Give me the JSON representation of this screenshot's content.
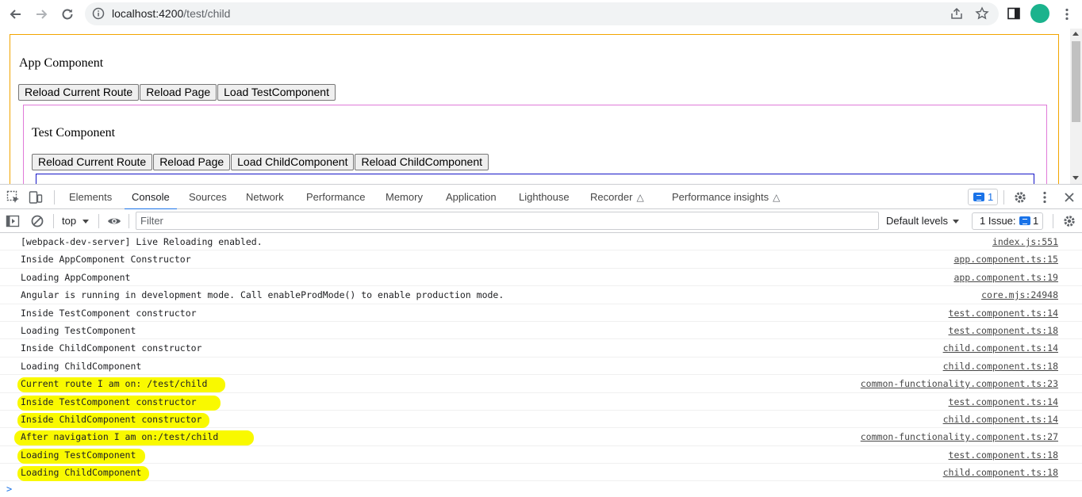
{
  "browser": {
    "url_host": "localhost:4200",
    "url_path": "/test/child"
  },
  "page": {
    "app_title": "App Component",
    "app_buttons": [
      "Reload Current Route",
      "Reload Page",
      "Load TestComponent"
    ],
    "test_title": "Test Component",
    "test_buttons": [
      "Reload Current Route",
      "Reload Page",
      "Load ChildComponent",
      "Reload ChildComponent"
    ]
  },
  "devtools": {
    "tabs": [
      "Elements",
      "Console",
      "Sources",
      "Network",
      "Performance",
      "Memory",
      "Application",
      "Lighthouse",
      "Recorder",
      "Performance insights"
    ],
    "active_tab": "Console",
    "message_count": "1",
    "context": "top",
    "filter_placeholder": "Filter",
    "levels_label": "Default levels",
    "issues_label": "1 Issue:",
    "issues_count": "1",
    "accent_color": "#1a73e8",
    "highlight_color": "#f9f900"
  },
  "console": {
    "rows": [
      {
        "message": "[webpack-dev-server] Live Reloading enabled.",
        "source": "index.js:551",
        "highlighted": false
      },
      {
        "message": "Inside AppComponent Constructor",
        "source": "app.component.ts:15",
        "highlighted": false
      },
      {
        "message": "Loading AppComponent",
        "source": "app.component.ts:19",
        "highlighted": false
      },
      {
        "message": "Angular is running in development mode. Call enableProdMode() to enable production mode.",
        "source": "core.mjs:24948",
        "highlighted": false
      },
      {
        "message": "Inside TestComponent constructor",
        "source": "test.component.ts:14",
        "highlighted": false
      },
      {
        "message": "Loading TestComponent",
        "source": "test.component.ts:18",
        "highlighted": false
      },
      {
        "message": "Inside ChildComponent constructor",
        "source": "child.component.ts:14",
        "highlighted": false
      },
      {
        "message": "Loading ChildComponent",
        "source": "child.component.ts:18",
        "highlighted": false
      },
      {
        "message": "Current route I am on: /test/child",
        "source": "common-functionality.component.ts:23",
        "highlighted": true
      },
      {
        "message": "Inside TestComponent constructor",
        "source": "test.component.ts:14",
        "highlighted": true
      },
      {
        "message": "Inside ChildComponent constructor",
        "source": "child.component.ts:14",
        "highlighted": true
      },
      {
        "message": "After navigation I am on:/test/child",
        "source": "common-functionality.component.ts:27",
        "highlighted": true
      },
      {
        "message": "Loading TestComponent",
        "source": "test.component.ts:18",
        "highlighted": true
      },
      {
        "message": "Loading ChildComponent",
        "source": "child.component.ts:18",
        "highlighted": true
      }
    ],
    "prompt": ">"
  }
}
